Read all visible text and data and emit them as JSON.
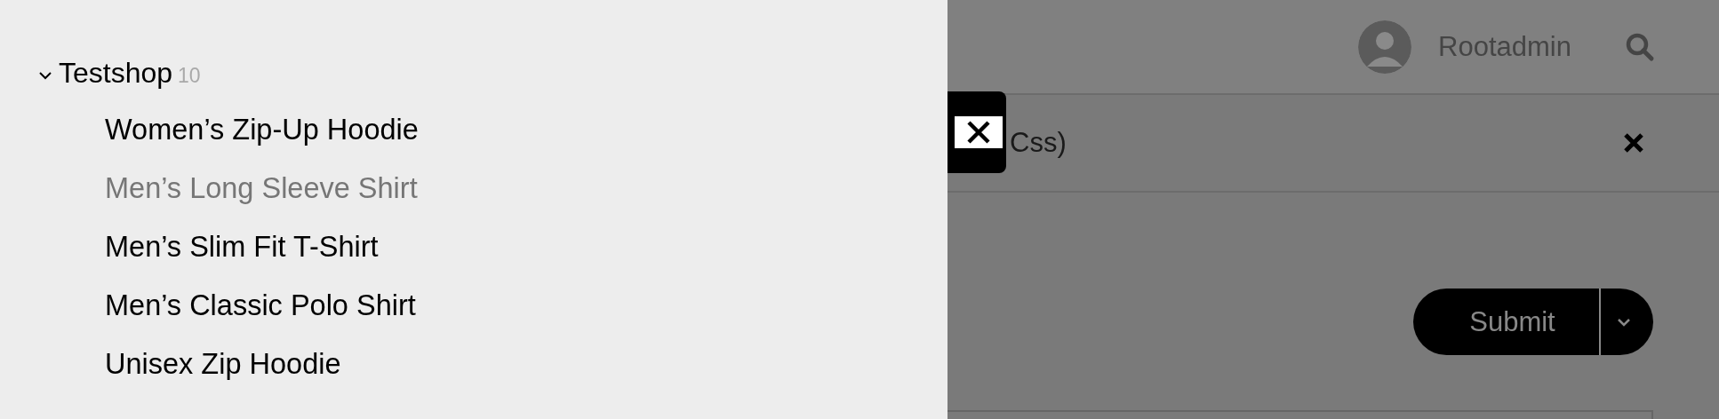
{
  "tree": {
    "label": "Testshop",
    "count": "10",
    "expanded": true,
    "children": [
      {
        "label": "Women’s Zip-Up Hoodie",
        "disabled": false
      },
      {
        "label": "Men’s Long Sleeve Shirt",
        "disabled": true
      },
      {
        "label": "Men’s Slim Fit T-Shirt",
        "disabled": false
      },
      {
        "label": "Men’s Classic Polo Shirt",
        "disabled": false
      },
      {
        "label": "Unisex Zip Hoodie",
        "disabled": false
      }
    ]
  },
  "header": {
    "user": "Rootadmin"
  },
  "notice": {
    "text": "Css)"
  },
  "actions": {
    "submit": "Submit"
  }
}
